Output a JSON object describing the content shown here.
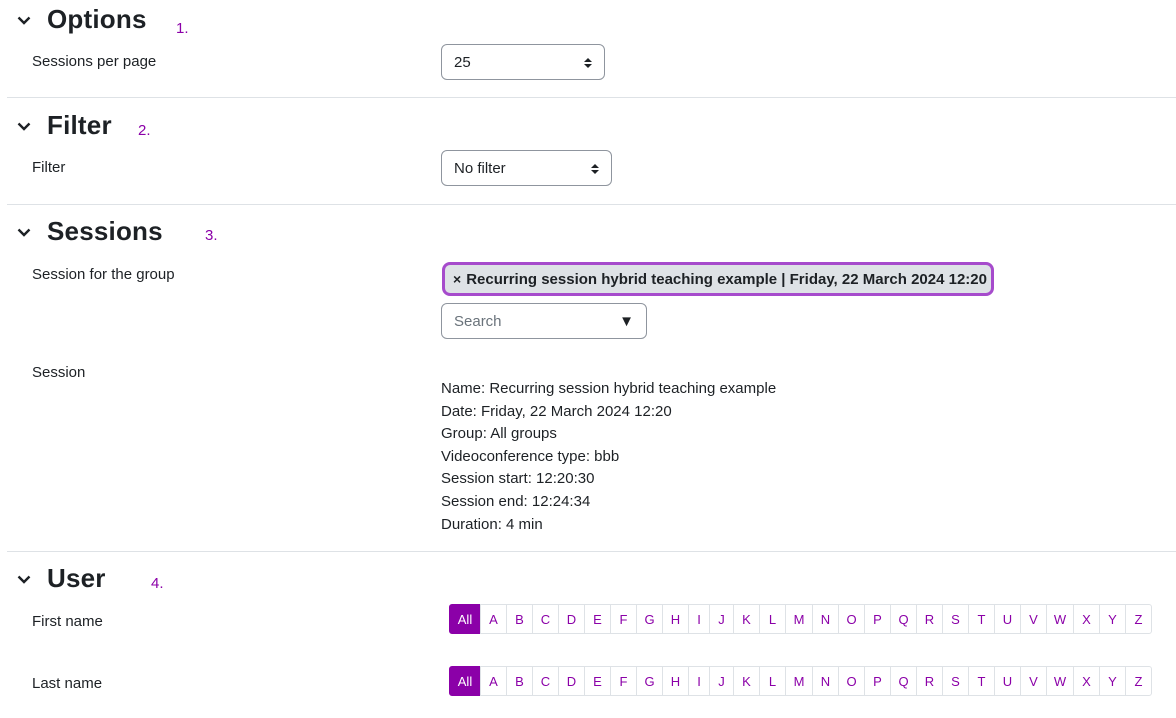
{
  "sections": {
    "options": {
      "title": "Options",
      "annotation": "1."
    },
    "filter": {
      "title": "Filter",
      "annotation": "2."
    },
    "sessions": {
      "title": "Sessions",
      "annotation": "3."
    },
    "user": {
      "title": "User",
      "annotation": "4."
    }
  },
  "options": {
    "sessions_per_page_label": "Sessions per page",
    "sessions_per_page_value": "25"
  },
  "filter": {
    "filter_label": "Filter",
    "filter_value": "No filter"
  },
  "sessions": {
    "group_label": "Session for the group",
    "selected_chip_x": "×",
    "selected_chip": "Recurring session hybrid teaching example | Friday, 22 March 2024 12:20",
    "search_placeholder": "Search",
    "search_caret": "▼",
    "session_label": "Session",
    "info": [
      "Name: Recurring session hybrid teaching example",
      "Date: Friday, 22 March 2024 12:20",
      "Group: All groups",
      "Videoconference type: bbb",
      "Session start: 12:20:30",
      "Session end: 12:24:34",
      "Duration: 4 min"
    ]
  },
  "user": {
    "first_name_label": "First name",
    "last_name_label": "Last name",
    "letters": [
      "All",
      "A",
      "B",
      "C",
      "D",
      "E",
      "F",
      "G",
      "H",
      "I",
      "J",
      "K",
      "L",
      "M",
      "N",
      "O",
      "P",
      "Q",
      "R",
      "S",
      "T",
      "U",
      "V",
      "W",
      "X",
      "Y",
      "Z"
    ]
  },
  "colors": {
    "accent": "#8b00a8",
    "chip_border": "#a64bcc",
    "divider": "#dee2e6"
  }
}
